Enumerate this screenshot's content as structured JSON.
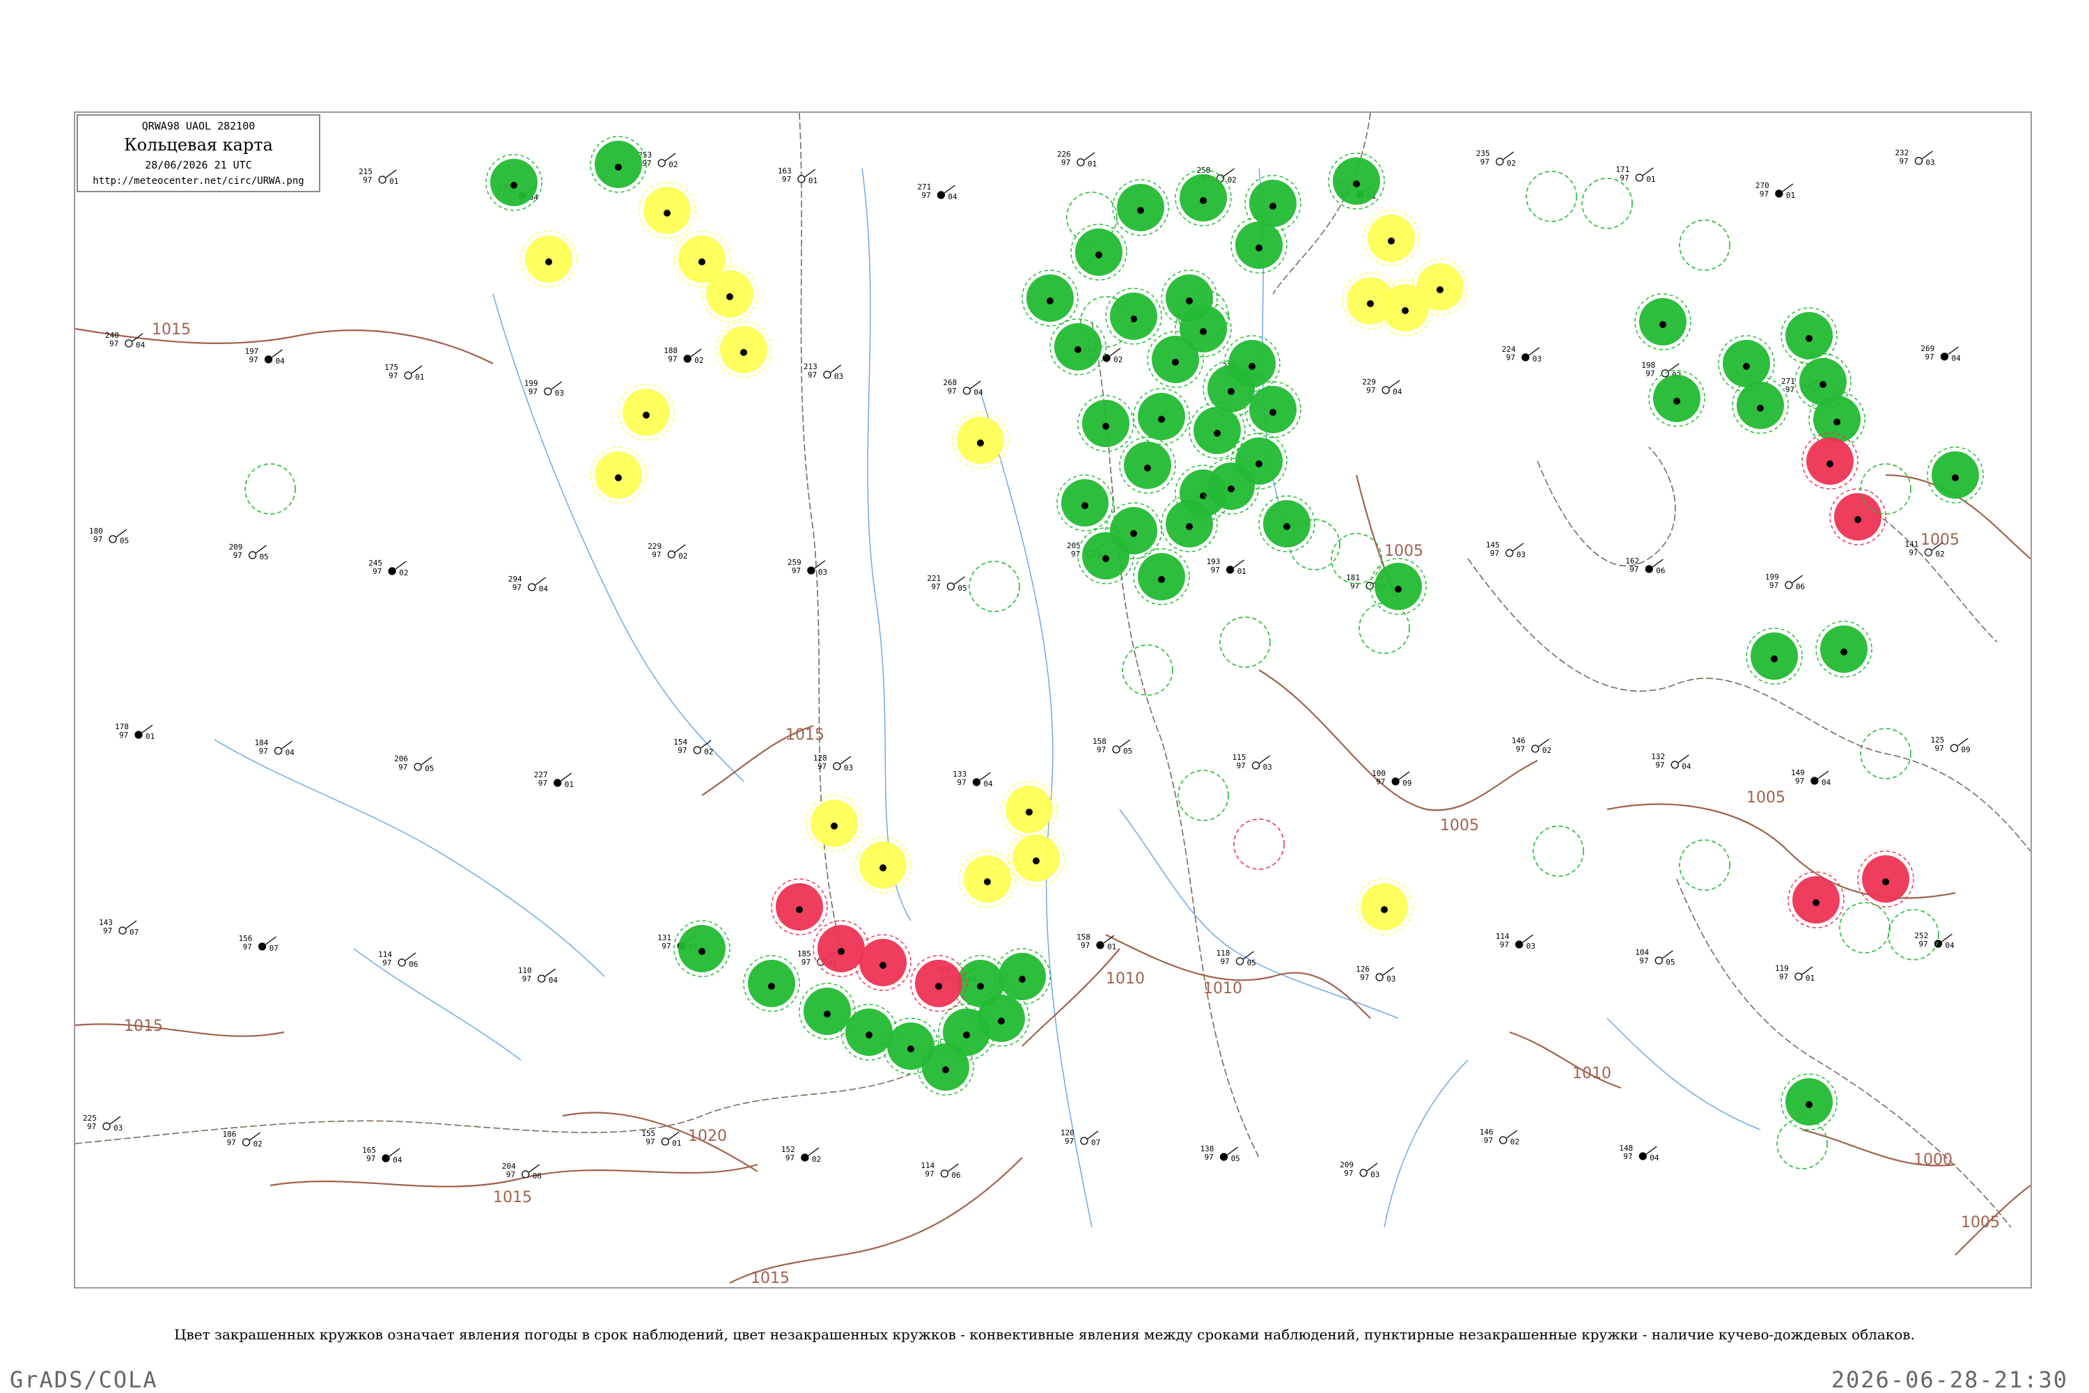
{
  "header": {
    "code": "QRWA98  UAOL  282100",
    "title": "Кольцевая карта",
    "date": "28/06/2026 21 UTC",
    "url": "http://meteocenter.net/circ/URWA.png"
  },
  "legend_note": "Цвет закрашенных кружков означает явления погоды в срок наблюдений, цвет незакрашенных кружков - конвективные явления между сроками наблюдений, пунктирные незакрашенные кружки - наличие кучево-дождевых облаков.",
  "footer": {
    "left": "GrADS/COLA",
    "right": "2026-06-28-21:30"
  },
  "colors": {
    "green": "#22bb33",
    "yellow": "#ffff55",
    "red": "#ee3355",
    "isobar": "#a0624f",
    "river": "#6fa8e8",
    "border": "#7a6a5a"
  },
  "isobar_labels": [
    {
      "text": "1015"
    },
    {
      "text": "1015"
    },
    {
      "text": "1015"
    },
    {
      "text": "1020"
    },
    {
      "text": "1015"
    },
    {
      "text": "1015"
    },
    {
      "text": "1010"
    },
    {
      "text": "1010"
    },
    {
      "text": "1005"
    },
    {
      "text": "1005"
    },
    {
      "text": "1005"
    },
    {
      "text": "1000"
    },
    {
      "text": "1005"
    },
    {
      "text": "1010"
    },
    {
      "text": "1005"
    }
  ],
  "stations": [
    {
      "t": "190",
      "p": "97",
      "v": "02"
    },
    {
      "t": "164",
      "p": "97",
      "v": "03"
    },
    {
      "t": "215",
      "p": "97",
      "v": "01"
    },
    {
      "t": "142",
      "p": "97",
      "v": "04"
    },
    {
      "t": "253",
      "p": "97",
      "v": "02"
    },
    {
      "t": "163",
      "p": "97",
      "v": "01"
    },
    {
      "t": "271",
      "p": "97",
      "v": "04"
    },
    {
      "t": "226",
      "p": "97",
      "v": "01"
    },
    {
      "t": "258",
      "p": "97",
      "v": "02"
    },
    {
      "t": "254",
      "p": "97",
      "v": "01"
    },
    {
      "t": "235",
      "p": "97",
      "v": "02"
    },
    {
      "t": "171",
      "p": "97",
      "v": "01"
    },
    {
      "t": "270",
      "p": "97",
      "v": "01"
    },
    {
      "t": "232",
      "p": "97",
      "v": "03"
    },
    {
      "t": "240",
      "p": "97",
      "v": "04"
    },
    {
      "t": "197",
      "p": "97",
      "v": "04"
    },
    {
      "t": "175",
      "p": "97",
      "v": "01"
    },
    {
      "t": "199",
      "p": "97",
      "v": "03"
    },
    {
      "t": "188",
      "p": "97",
      "v": "02"
    },
    {
      "t": "213",
      "p": "97",
      "v": "03"
    },
    {
      "t": "268",
      "p": "97",
      "v": "04"
    },
    {
      "t": "165",
      "p": "97",
      "v": "02"
    },
    {
      "t": "222",
      "p": "97",
      "v": "01"
    },
    {
      "t": "229",
      "p": "97",
      "v": "04"
    },
    {
      "t": "224",
      "p": "97",
      "v": "03"
    },
    {
      "t": "198",
      "p": "97",
      "v": "02"
    },
    {
      "t": "271",
      "p": "97",
      "v": "01"
    },
    {
      "t": "269",
      "p": "97",
      "v": "04"
    },
    {
      "t": "180",
      "p": "97",
      "v": "05"
    },
    {
      "t": "209",
      "p": "97",
      "v": "05"
    },
    {
      "t": "245",
      "p": "97",
      "v": "02"
    },
    {
      "t": "294",
      "p": "97",
      "v": "04"
    },
    {
      "t": "229",
      "p": "97",
      "v": "02"
    },
    {
      "t": "259",
      "p": "97",
      "v": "03"
    },
    {
      "t": "221",
      "p": "97",
      "v": "05"
    },
    {
      "t": "205",
      "p": "97",
      "v": "04"
    },
    {
      "t": "193",
      "p": "97",
      "v": "01"
    },
    {
      "t": "181",
      "p": "97",
      "v": "07"
    },
    {
      "t": "145",
      "p": "97",
      "v": "03"
    },
    {
      "t": "162",
      "p": "97",
      "v": "06"
    },
    {
      "t": "199",
      "p": "97",
      "v": "06"
    },
    {
      "t": "141",
      "p": "97",
      "v": "02"
    },
    {
      "t": "178",
      "p": "97",
      "v": "01"
    },
    {
      "t": "184",
      "p": "97",
      "v": "04"
    },
    {
      "t": "206",
      "p": "97",
      "v": "05"
    },
    {
      "t": "227",
      "p": "97",
      "v": "01"
    },
    {
      "t": "154",
      "p": "97",
      "v": "02"
    },
    {
      "t": "128",
      "p": "97",
      "v": "03"
    },
    {
      "t": "133",
      "p": "97",
      "v": "04"
    },
    {
      "t": "158",
      "p": "97",
      "v": "05"
    },
    {
      "t": "115",
      "p": "97",
      "v": "03"
    },
    {
      "t": "100",
      "p": "97",
      "v": "09"
    },
    {
      "t": "146",
      "p": "97",
      "v": "02"
    },
    {
      "t": "132",
      "p": "97",
      "v": "04"
    },
    {
      "t": "149",
      "p": "97",
      "v": "04"
    },
    {
      "t": "125",
      "p": "97",
      "v": "09"
    },
    {
      "t": "143",
      "p": "97",
      "v": "07"
    },
    {
      "t": "156",
      "p": "97",
      "v": "07"
    },
    {
      "t": "114",
      "p": "97",
      "v": "06"
    },
    {
      "t": "110",
      "p": "97",
      "v": "04"
    },
    {
      "t": "131",
      "p": "97",
      "v": "03"
    },
    {
      "t": "185",
      "p": "97",
      "v": "01"
    },
    {
      "t": "200",
      "p": "97",
      "v": "01"
    },
    {
      "t": "158",
      "p": "97",
      "v": "01"
    },
    {
      "t": "118",
      "p": "97",
      "v": "05"
    },
    {
      "t": "126",
      "p": "97",
      "v": "03"
    },
    {
      "t": "114",
      "p": "97",
      "v": "03"
    },
    {
      "t": "104",
      "p": "97",
      "v": "05"
    },
    {
      "t": "119",
      "p": "97",
      "v": "01"
    },
    {
      "t": "252",
      "p": "97",
      "v": "04"
    },
    {
      "t": "225",
      "p": "97",
      "v": "03"
    },
    {
      "t": "186",
      "p": "97",
      "v": "02"
    },
    {
      "t": "165",
      "p": "97",
      "v": "04"
    },
    {
      "t": "204",
      "p": "97",
      "v": "06"
    },
    {
      "t": "155",
      "p": "97",
      "v": "01"
    },
    {
      "t": "152",
      "p": "97",
      "v": "02"
    },
    {
      "t": "114",
      "p": "97",
      "v": "06"
    },
    {
      "t": "120",
      "p": "97",
      "v": "07"
    },
    {
      "t": "138",
      "p": "97",
      "v": "05"
    },
    {
      "t": "209",
      "p": "97",
      "v": "03"
    },
    {
      "t": "146",
      "p": "97",
      "v": "02"
    },
    {
      "t": "148",
      "p": "97",
      "v": "04"
    }
  ],
  "phenomena": [
    {
      "kind": "fill",
      "color": "green"
    },
    {
      "kind": "fill",
      "color": "green"
    },
    {
      "kind": "fill",
      "color": "green"
    },
    {
      "kind": "fill",
      "color": "green"
    },
    {
      "kind": "fill",
      "color": "green"
    },
    {
      "kind": "fill",
      "color": "green"
    },
    {
      "kind": "fill",
      "color": "green"
    },
    {
      "kind": "fill",
      "color": "green"
    },
    {
      "kind": "fill",
      "color": "green"
    },
    {
      "kind": "fill",
      "color": "green"
    },
    {
      "kind": "fill",
      "color": "green"
    },
    {
      "kind": "fill",
      "color": "green"
    },
    {
      "kind": "fill",
      "color": "green"
    },
    {
      "kind": "fill",
      "color": "green"
    },
    {
      "kind": "fill",
      "color": "green"
    },
    {
      "kind": "fill",
      "color": "green"
    },
    {
      "kind": "fill",
      "color": "green"
    },
    {
      "kind": "fill",
      "color": "green"
    },
    {
      "kind": "fill",
      "color": "green"
    },
    {
      "kind": "fill",
      "color": "green"
    },
    {
      "kind": "fill",
      "color": "green"
    },
    {
      "kind": "fill",
      "color": "green"
    },
    {
      "kind": "fill",
      "color": "green"
    },
    {
      "kind": "fill",
      "color": "green"
    },
    {
      "kind": "fill",
      "color": "green"
    },
    {
      "kind": "fill",
      "color": "green"
    },
    {
      "kind": "fill",
      "color": "green"
    },
    {
      "kind": "fill",
      "color": "green"
    },
    {
      "kind": "fill",
      "color": "green"
    },
    {
      "kind": "fill",
      "color": "green"
    },
    {
      "kind": "fill",
      "color": "green"
    },
    {
      "kind": "fill",
      "color": "green"
    },
    {
      "kind": "fill",
      "color": "green"
    },
    {
      "kind": "fill",
      "color": "green"
    },
    {
      "kind": "fill",
      "color": "green"
    },
    {
      "kind": "fill",
      "color": "green"
    },
    {
      "kind": "fill",
      "color": "green"
    },
    {
      "kind": "fill",
      "color": "green"
    },
    {
      "kind": "fill",
      "color": "green"
    },
    {
      "kind": "fill",
      "color": "green"
    },
    {
      "kind": "fill",
      "color": "green"
    },
    {
      "kind": "fill",
      "color": "green"
    },
    {
      "kind": "fill",
      "color": "green"
    },
    {
      "kind": "fill",
      "color": "green"
    },
    {
      "kind": "fill",
      "color": "green"
    },
    {
      "kind": "fill",
      "color": "green"
    },
    {
      "kind": "fill",
      "color": "green"
    },
    {
      "kind": "fill",
      "color": "green"
    },
    {
      "kind": "fill",
      "color": "green"
    },
    {
      "kind": "fill",
      "color": "green"
    },
    {
      "kind": "fill",
      "color": "green"
    },
    {
      "kind": "fill",
      "color": "green"
    },
    {
      "kind": "fill",
      "color": "yellow"
    },
    {
      "kind": "fill",
      "color": "yellow"
    },
    {
      "kind": "fill",
      "color": "yellow"
    },
    {
      "kind": "fill",
      "color": "yellow"
    },
    {
      "kind": "fill",
      "color": "yellow"
    },
    {
      "kind": "fill",
      "color": "yellow"
    },
    {
      "kind": "fill",
      "color": "yellow"
    },
    {
      "kind": "fill",
      "color": "yellow"
    },
    {
      "kind": "fill",
      "color": "yellow"
    },
    {
      "kind": "fill",
      "color": "yellow"
    },
    {
      "kind": "fill",
      "color": "yellow"
    },
    {
      "kind": "fill",
      "color": "yellow"
    },
    {
      "kind": "fill",
      "color": "yellow"
    },
    {
      "kind": "fill",
      "color": "yellow"
    },
    {
      "kind": "fill",
      "color": "yellow"
    },
    {
      "kind": "fill",
      "color": "yellow"
    },
    {
      "kind": "fill",
      "color": "yellow"
    },
    {
      "kind": "fill",
      "color": "yellow"
    },
    {
      "kind": "fill",
      "color": "red"
    },
    {
      "kind": "fill",
      "color": "red"
    },
    {
      "kind": "fill",
      "color": "red"
    },
    {
      "kind": "fill",
      "color": "red"
    },
    {
      "kind": "fill",
      "color": "red"
    },
    {
      "kind": "fill",
      "color": "red"
    },
    {
      "kind": "fill",
      "color": "red"
    },
    {
      "kind": "fill",
      "color": "red"
    },
    {
      "kind": "ring",
      "color": "green"
    },
    {
      "kind": "ring",
      "color": "green"
    },
    {
      "kind": "ring",
      "color": "green"
    },
    {
      "kind": "ring",
      "color": "green"
    },
    {
      "kind": "ring",
      "color": "green"
    },
    {
      "kind": "ring",
      "color": "green"
    },
    {
      "kind": "ring",
      "color": "green"
    },
    {
      "kind": "ring",
      "color": "green"
    },
    {
      "kind": "ring",
      "color": "green"
    },
    {
      "kind": "ring",
      "color": "green"
    },
    {
      "kind": "ring",
      "color": "green"
    },
    {
      "kind": "ring",
      "color": "green"
    },
    {
      "kind": "ring",
      "color": "green"
    },
    {
      "kind": "ring",
      "color": "green"
    },
    {
      "kind": "ring",
      "color": "green"
    },
    {
      "kind": "ring",
      "color": "green"
    },
    {
      "kind": "ring",
      "color": "green"
    },
    {
      "kind": "ring",
      "color": "green"
    },
    {
      "kind": "ring",
      "color": "green"
    },
    {
      "kind": "ring",
      "color": "green"
    },
    {
      "kind": "ring",
      "color": "red"
    },
    {
      "kind": "ring",
      "color": "green"
    }
  ]
}
